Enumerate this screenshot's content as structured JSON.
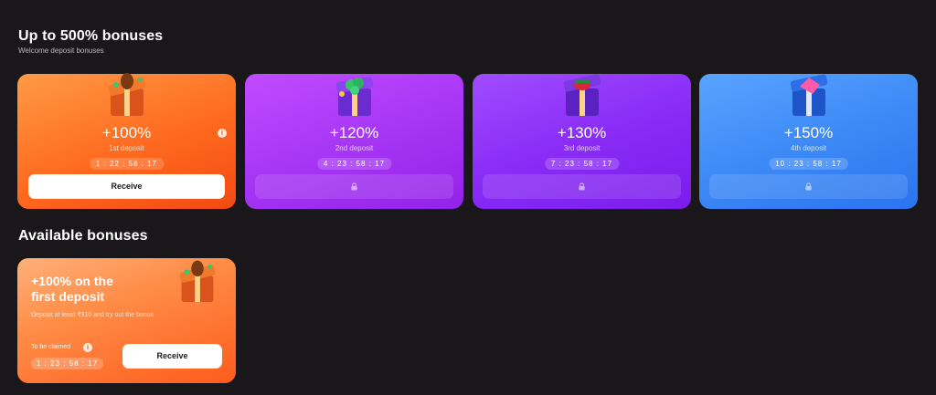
{
  "welcome": {
    "title": "Up to 500% bonuses",
    "subtitle": "Welcome deposit bonuses",
    "cards": [
      {
        "percent": "+100%",
        "deposit": "1st deposit",
        "timer": "1 : 22 : 58 : 17",
        "button": "Receive",
        "locked": false,
        "gift_color": "orange"
      },
      {
        "percent": "+120%",
        "deposit": "2nd deposit",
        "timer": "4 : 23 : 58 : 17",
        "locked": true,
        "gift_color": "purple"
      },
      {
        "percent": "+130%",
        "deposit": "3rd deposit",
        "timer": "7 : 23 : 58 : 17",
        "locked": true,
        "gift_color": "purple"
      },
      {
        "percent": "+150%",
        "deposit": "4th deposit",
        "timer": "10 : 23 : 58 : 17",
        "locked": true,
        "gift_color": "blue"
      }
    ]
  },
  "available": {
    "title": "Available bonuses",
    "card": {
      "title": "+100% on the first deposit",
      "description": "Deposit at least ₹910 and try out the bonus",
      "claim_label": "To be claimed",
      "timer": "1 : 23 : 58 : 17",
      "button": "Receive"
    }
  },
  "colors": {
    "background": "#19171a",
    "orange": "#ff6a1f",
    "purple": "#a736f5",
    "violet": "#8a2cf6",
    "blue": "#3d8af7"
  }
}
